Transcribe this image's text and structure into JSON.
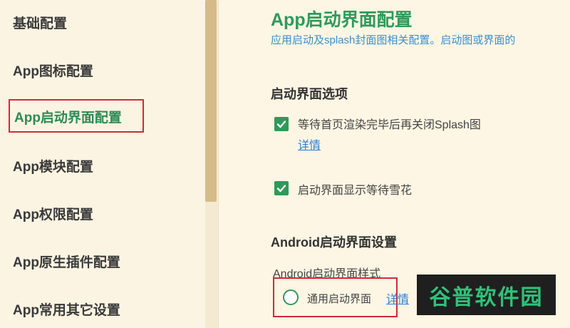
{
  "sidebar": {
    "items": [
      {
        "label": "基础配置"
      },
      {
        "label": "App图标配置"
      },
      {
        "label": "App启动界面配置"
      },
      {
        "label": "App模块配置"
      },
      {
        "label": "App权限配置"
      },
      {
        "label": "App原生插件配置"
      },
      {
        "label": "App常用其它设置"
      }
    ],
    "active_index": 2
  },
  "main": {
    "title": "App启动界面配置",
    "description": "应用启动及splash封面图相关配置。启动图或界面的",
    "splash_section": {
      "title": "启动界面选项",
      "options": [
        {
          "label": "等待首页渲染完毕后再关闭Splash图",
          "checked": true,
          "link": "详情"
        },
        {
          "label": "启动界面显示等待雪花",
          "checked": true
        }
      ]
    },
    "android_section": {
      "title": "Android启动界面设置",
      "style_label": "Android启动界面样式",
      "radio_label": "通用启动界面",
      "radio_link": "详情"
    }
  },
  "watermark": {
    "text": "谷普软件园"
  },
  "colors": {
    "accent": "#2e9a5a",
    "link": "#2a7fd6",
    "highlight_box": "#d22a3a",
    "background": "#fdf6e4"
  }
}
